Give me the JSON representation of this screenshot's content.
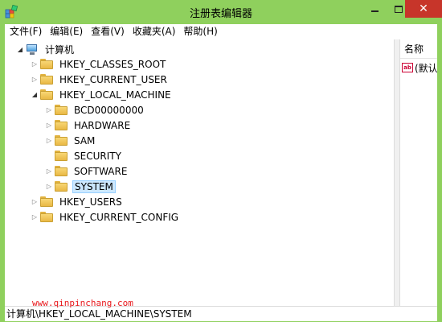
{
  "window": {
    "title": "注册表编辑器",
    "close_glyph": "✕"
  },
  "menu": [
    {
      "label": "文件(F)"
    },
    {
      "label": "编辑(E)"
    },
    {
      "label": "查看(V)"
    },
    {
      "label": "收藏夹(A)"
    },
    {
      "label": "帮助(H)"
    }
  ],
  "tree": {
    "root": {
      "label": "计算机",
      "expander": "◢"
    },
    "hives": [
      {
        "label": "HKEY_CLASSES_ROOT",
        "expander": "▷"
      },
      {
        "label": "HKEY_CURRENT_USER",
        "expander": "▷"
      },
      {
        "label": "HKEY_LOCAL_MACHINE",
        "expander": "◢"
      },
      {
        "label": "HKEY_USERS",
        "expander": "▷"
      },
      {
        "label": "HKEY_CURRENT_CONFIG",
        "expander": "▷"
      }
    ],
    "hklm_children": [
      {
        "label": "BCD00000000",
        "expander": "▷"
      },
      {
        "label": "HARDWARE",
        "expander": "▷"
      },
      {
        "label": "SAM",
        "expander": "▷"
      },
      {
        "label": "SECURITY",
        "expander": ""
      },
      {
        "label": "SOFTWARE",
        "expander": "▷"
      },
      {
        "label": "SYSTEM",
        "expander": "▷",
        "selected": true
      }
    ]
  },
  "list": {
    "column_name": "名称",
    "row_label": "(默认)",
    "row_icon_text": "ab"
  },
  "status": {
    "path": "计算机\\HKEY_LOCAL_MACHINE\\SYSTEM"
  },
  "watermark": "www.qinpinchang.com",
  "colors": {
    "titlebar": "#8fd05d",
    "close_button": "#c7352a",
    "selection": "#cce8ff",
    "watermark": "#e8191d"
  }
}
